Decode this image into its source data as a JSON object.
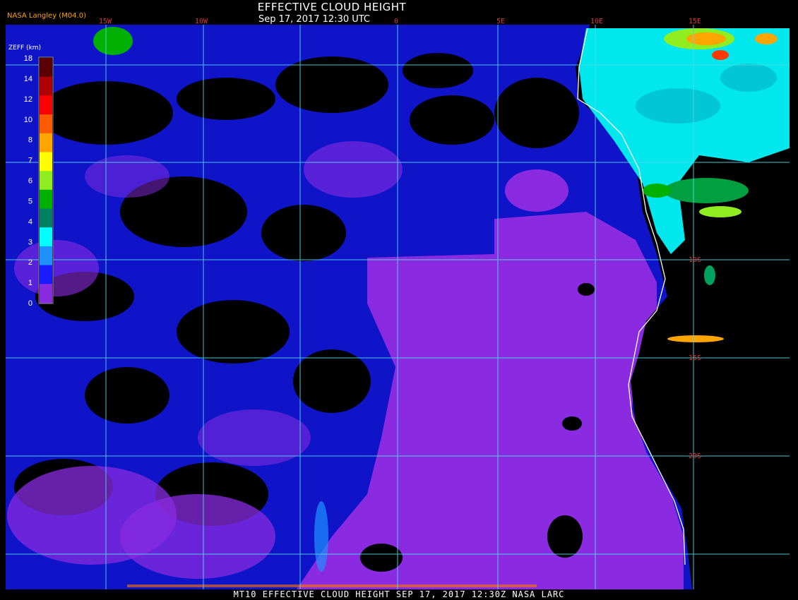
{
  "header": {
    "title": "EFFECTIVE CLOUD HEIGHT",
    "subtitle": "Sep 17, 2017 12:30 UTC",
    "credit": "NASA Langley (M04.0)"
  },
  "footer": {
    "caption": "MT10  EFFECTIVE CLOUD HEIGHT  SEP 17, 2017 12:30Z  NASA LARC"
  },
  "colors": {
    "background": "#000000",
    "grid": "#4fd9e8",
    "coast": "#ffffff",
    "low_cloud_purple": "#8a2be2",
    "cloud_blue": "#1a1aff",
    "cloud_cyan": "#00ffff",
    "label_red": "#d43c3c"
  },
  "longitude_labels": [
    "15W",
    "10W",
    "0",
    "5E",
    "10E",
    "15E"
  ],
  "latitude_labels": [
    "10S",
    "15S",
    "20S"
  ],
  "legend": {
    "unit_label": "ZEFF (km)",
    "ticks": [
      "18",
      "14",
      "12",
      "10",
      "8",
      "7",
      "6",
      "5",
      "4",
      "3",
      "2",
      "1",
      "0"
    ],
    "bands": [
      {
        "color": "#5a0000"
      },
      {
        "color": "#b00000"
      },
      {
        "color": "#ff0000"
      },
      {
        "color": "#ff5a00"
      },
      {
        "color": "#ffa500"
      },
      {
        "color": "#ffff00"
      },
      {
        "color": "#90ee20"
      },
      {
        "color": "#00b000"
      },
      {
        "color": "#008060"
      },
      {
        "color": "#00ffff"
      },
      {
        "color": "#1e90ff"
      },
      {
        "color": "#1a1aff"
      },
      {
        "color": "#8a2be2"
      }
    ]
  }
}
